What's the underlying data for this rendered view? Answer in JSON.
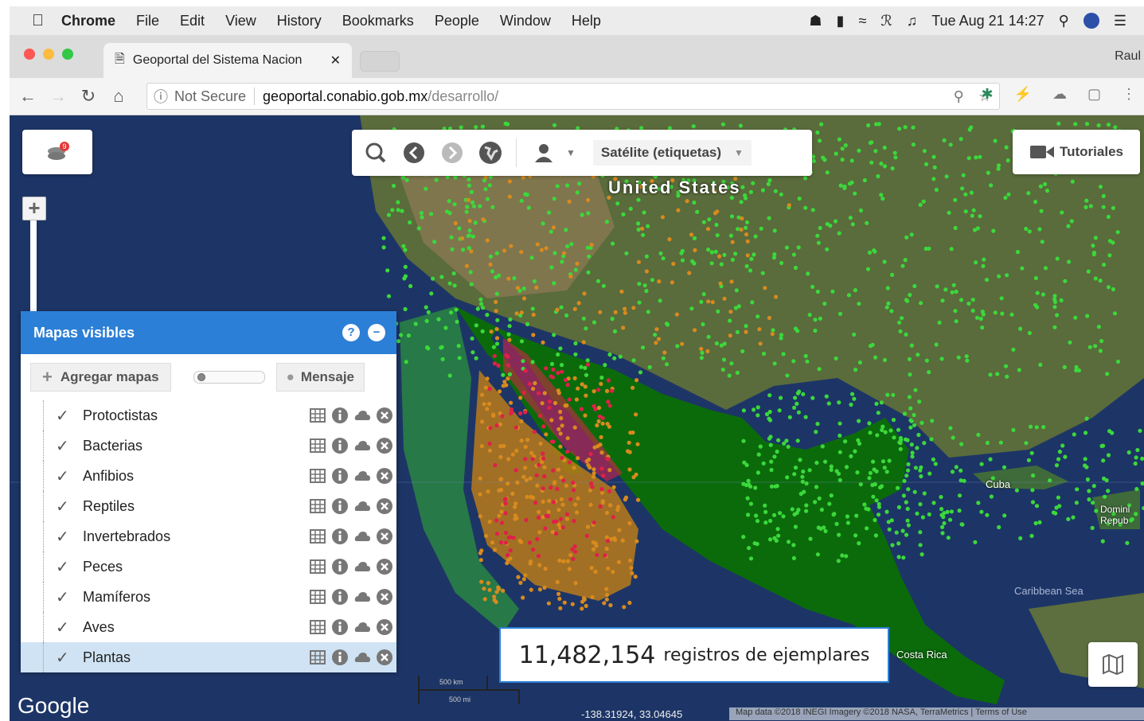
{
  "menubar": {
    "app": "Chrome",
    "items": [
      "File",
      "Edit",
      "View",
      "History",
      "Bookmarks",
      "People",
      "Window",
      "Help"
    ],
    "datetime": "Tue Aug 21  14:27"
  },
  "tab": {
    "title": "Geoportal del Sistema Nacion",
    "profile": "Raul"
  },
  "address": {
    "security": "Not Secure",
    "host": "geoportal.conabio.gob.mx",
    "path": "/desarrollo/"
  },
  "toolbar": {
    "basemap": "Satélite (etiquetas)"
  },
  "tutorials_label": "Tutoriales",
  "layers_badge": "9",
  "panel": {
    "title": "Mapas visibles",
    "add_label": "Agregar mapas",
    "message_label": "Mensaje",
    "opacity": 0.05,
    "layers": [
      {
        "name": "Protoctistas",
        "checked": true
      },
      {
        "name": "Bacterias",
        "checked": true
      },
      {
        "name": "Anfibios",
        "checked": true
      },
      {
        "name": "Reptiles",
        "checked": true
      },
      {
        "name": "Invertebrados",
        "checked": true
      },
      {
        "name": "Peces",
        "checked": true
      },
      {
        "name": "Mamíferos",
        "checked": true
      },
      {
        "name": "Aves",
        "checked": true
      },
      {
        "name": "Plantas",
        "checked": true
      }
    ]
  },
  "records": {
    "count": "11,482,154",
    "label": "registros de ejemplares"
  },
  "map": {
    "labels": {
      "country": "United States",
      "cuba": "Cuba",
      "dominican": "Domini Repub",
      "caribbean": "Caribbean Sea",
      "costarica": "Costa Rica"
    },
    "coords": "-138.31924, 33.04645",
    "attribution": "Map data ©2018 INEGI Imagery ©2018 NASA, TerraMetrics | Terms of Use",
    "google": "Google",
    "scale_top": "500 km",
    "scale_bottom": "500 mi"
  },
  "colors": {
    "accent": "#2c7fd6",
    "ocean": "#1d3566",
    "land_dark": "#0b6b0b",
    "points_green": "#3bd83b",
    "points_orange": "#d88a1e",
    "points_red": "#e0204a"
  }
}
